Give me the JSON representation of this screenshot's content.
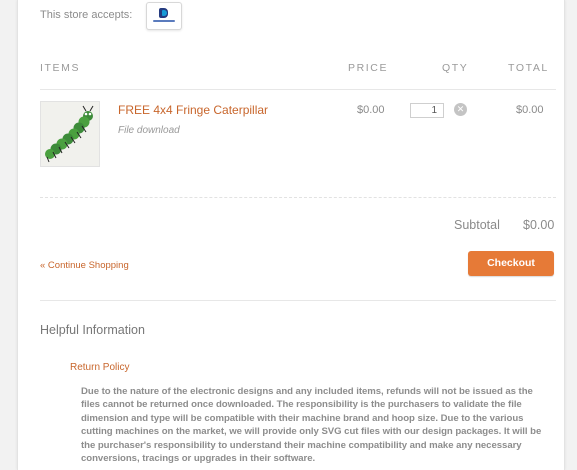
{
  "header": {
    "accepts_label": "This store accepts:",
    "payment_logo": "paypal-logo"
  },
  "cart": {
    "columns": {
      "items": "ITEMS",
      "price": "PRICE",
      "qty": "QTY",
      "total": "TOTAL"
    },
    "items": [
      {
        "title": "FREE 4x4 Fringe Caterpillar",
        "subtitle": "File download",
        "price": "$0.00",
        "qty": "1",
        "total": "$0.00",
        "thumbnail": "caterpillar-embroidery-image"
      }
    ],
    "subtotal_label": "Subtotal",
    "subtotal_value": "$0.00"
  },
  "actions": {
    "continue_label": "« Continue Shopping",
    "checkout_label": "Checkout"
  },
  "info": {
    "heading": "Helpful Information",
    "return_link": "Return Policy",
    "policy_text": "Due to the nature of the electronic designs and any included items, refunds will not be issued as the files cannot be returned once downloaded.  The responsibility is the purchasers to validate the file dimension and type will be compatible with their machine brand and hoop size.  Due to the various cutting machines on the market, we will provide only SVG cut files with our design packages. It will be the purchaser's responsibility to understand their machine compatibility and make any necessary conversions, tracings or upgrades in their software."
  },
  "colors": {
    "accent": "#c8662c",
    "button": "#e67a37",
    "text_muted": "#8a8a8a"
  }
}
